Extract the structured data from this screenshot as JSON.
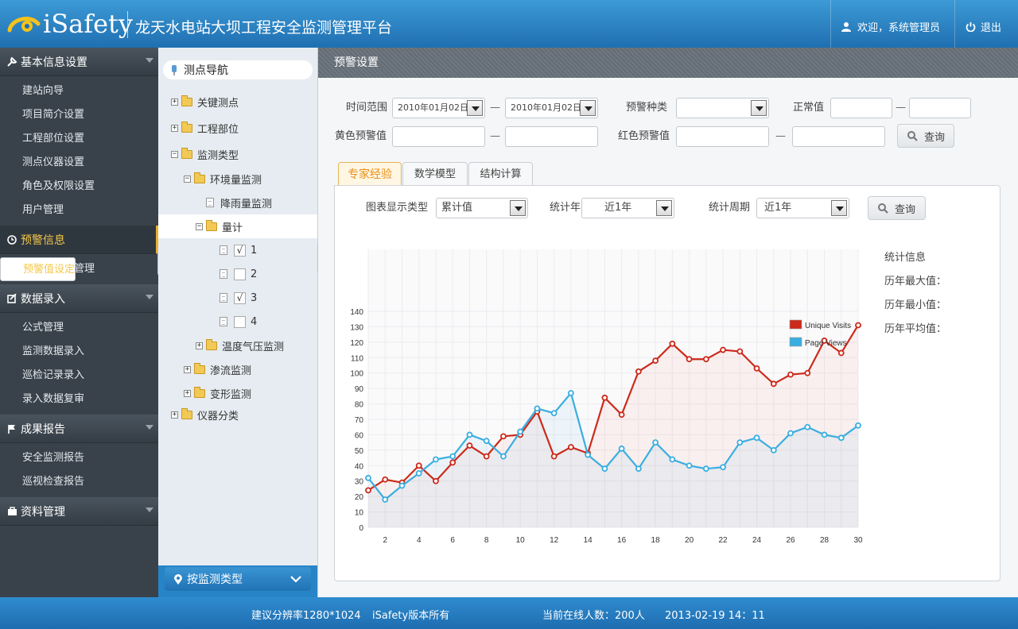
{
  "header": {
    "logo_text": "iSafety",
    "app_title": "龙天水电站大坝工程安全监测管理平台",
    "welcome": "欢迎，系统管理员",
    "logout": "退出"
  },
  "menu": {
    "sections": [
      {
        "label": "基本信息设置",
        "items": [
          "建站向导",
          "项目简介设置",
          "工程部位设置",
          "测点仪器设置",
          "角色及权限设置",
          "用户管理"
        ]
      },
      {
        "label": "预警信息",
        "items": [
          "预警值设定",
          "预警值信息管理"
        ]
      },
      {
        "label": "数据录入",
        "items": [
          "公式管理",
          "监测数据录入",
          "巡检记录录入",
          "录入数据复审"
        ]
      },
      {
        "label": "成果报告",
        "items": [
          "安全监测报告",
          "巡视检查报告"
        ]
      },
      {
        "label": "资料管理",
        "items": []
      }
    ]
  },
  "tree": {
    "title": "测点导航",
    "key_points": "关键测点",
    "parts": "工程部位",
    "types": "监测类型",
    "env": "环境量监测",
    "rain": "降雨量监测",
    "gauge": "量计",
    "checks": [
      {
        "label": "1",
        "mark": "√"
      },
      {
        "label": "2",
        "mark": ""
      },
      {
        "label": "3",
        "mark": "√"
      },
      {
        "label": "4",
        "mark": ""
      }
    ],
    "temp": "温度气压监测",
    "seepage": "渗流监测",
    "deform": "变形监测",
    "instruments": "仪器分类",
    "bottom_button": "按监测类型"
  },
  "main": {
    "title": "预警设置",
    "form": {
      "time_range_label": "时间范围",
      "date_from": "2010年01月02日",
      "date_to": "2010年01月02日",
      "dash": "—",
      "warn_type_label": "预警种类",
      "normal_label": "正常值",
      "yellow_label": "黄色预警值",
      "red_label": "红色预警值",
      "query": "查询"
    },
    "tabs": [
      "专家经验",
      "数学模型",
      "结构计算"
    ],
    "chart_controls": {
      "display_type_label": "图表显示类型",
      "display_type_value": "累计值",
      "year_label": "统计年限",
      "year_value": "近1年",
      "period_label": "统计周期",
      "period_value": "近1年",
      "query": "查询"
    },
    "stats": {
      "title": "统计信息",
      "max": "历年最大值：",
      "min": "历年最小值：",
      "avg": "历年平均值："
    }
  },
  "colors": {
    "unique": "#cc2a1a",
    "views": "#3aaee0"
  },
  "chart_data": {
    "type": "line",
    "x": [
      1,
      2,
      3,
      4,
      5,
      6,
      7,
      8,
      9,
      10,
      11,
      12,
      13,
      14,
      15,
      16,
      17,
      18,
      19,
      20,
      21,
      22,
      23,
      24,
      25,
      26,
      27,
      28,
      29,
      30
    ],
    "xticks": [
      2,
      4,
      6,
      8,
      10,
      12,
      14,
      16,
      18,
      20,
      22,
      24,
      26,
      28,
      30
    ],
    "ylim": [
      0,
      140
    ],
    "yticks": [
      0,
      10,
      20,
      30,
      40,
      50,
      60,
      70,
      80,
      90,
      100,
      110,
      120,
      130,
      140
    ],
    "series": [
      {
        "name": "Unique Visits",
        "values": [
          24,
          31,
          29,
          40,
          30,
          42,
          53,
          46,
          59,
          60,
          75,
          46,
          52,
          48,
          84,
          73,
          101,
          108,
          119,
          109,
          109,
          115,
          114,
          103,
          93,
          99,
          100,
          121,
          113,
          131
        ]
      },
      {
        "name": "Page Views",
        "values": [
          32,
          18,
          27,
          35,
          44,
          46,
          60,
          56,
          46,
          62,
          77,
          74,
          87,
          47,
          38,
          51,
          38,
          55,
          44,
          40,
          38,
          39,
          55,
          58,
          50,
          61,
          65,
          60,
          58,
          66
        ]
      }
    ]
  },
  "footer": {
    "resolution": "建议分辨率1280*1024",
    "copyright": "iSafety版本所有",
    "online": "当前在线人数：200人",
    "datetime": "2013-02-19  14：11"
  }
}
